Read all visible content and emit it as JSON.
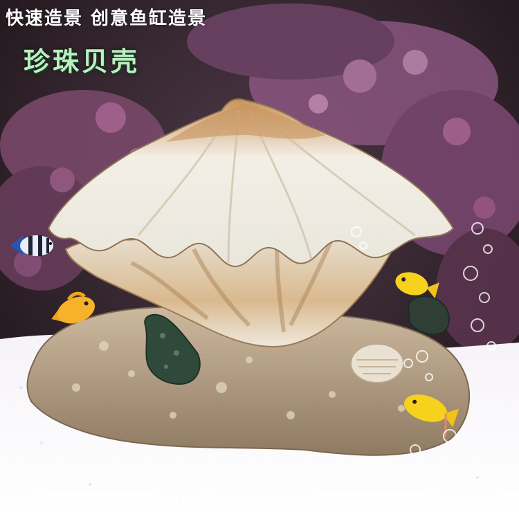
{
  "banner": {
    "tagline": "快速造景 创意鱼缸造景",
    "product_name": "珍珠贝壳"
  },
  "colors": {
    "tagline_text": "#ffffff",
    "product_name_text": "#b8f0c2",
    "coral_pink": "#b06a9a",
    "sand": "#bba58a",
    "shell_white": "#eeeadf",
    "shell_brown": "#c49a66",
    "fish_yellow": "#f7d21c",
    "fish_orange": "#f0a41e"
  },
  "icons": [
    "pearl-shell-ornament",
    "yellow-fish",
    "orange-fish",
    "striped-fish",
    "air-bubbles",
    "green-coral-rock"
  ]
}
